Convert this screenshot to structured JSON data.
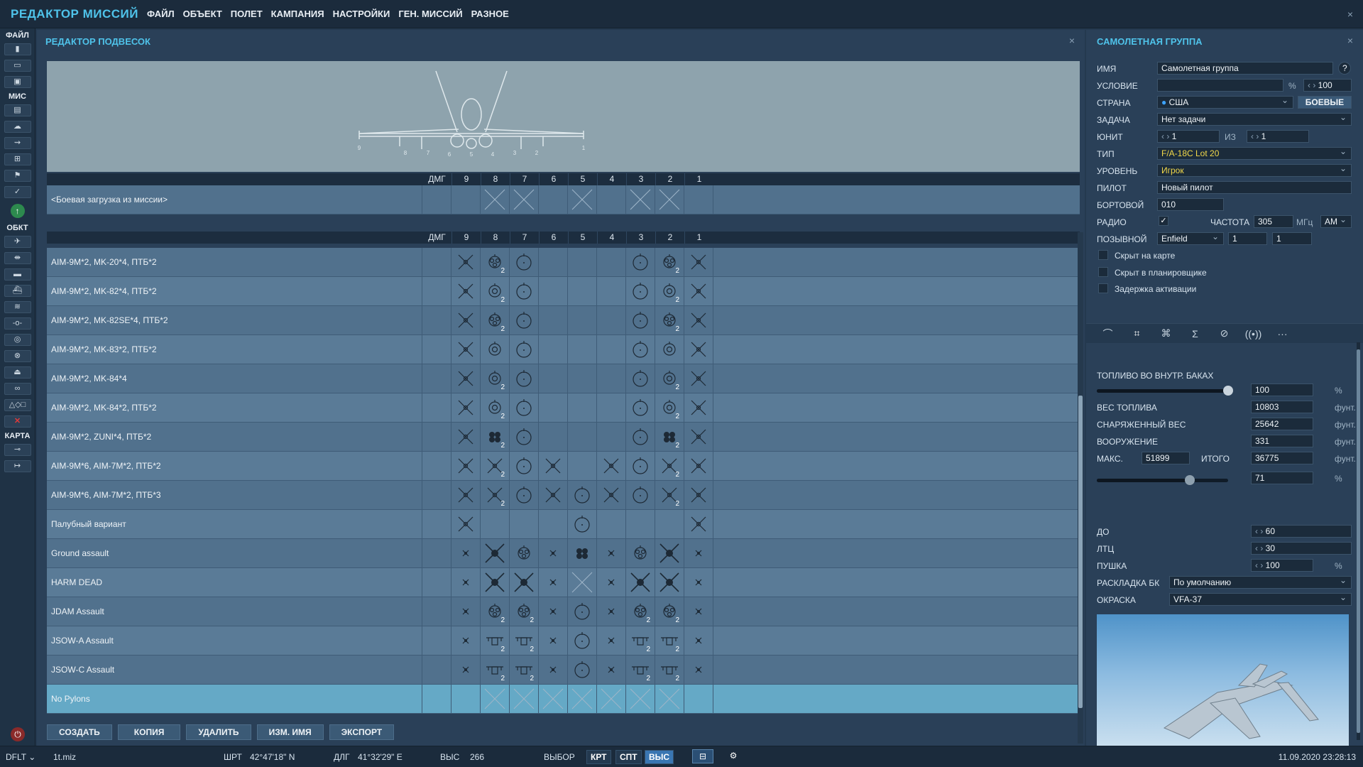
{
  "app": {
    "title": "РЕДАКТОР МИССИЙ",
    "menu": [
      "ФАЙЛ",
      "ОБЪЕКТ",
      "ПОЛЕТ",
      "КАМПАНИЯ",
      "НАСТРОЙКИ",
      "ГЕН. МИССИЙ",
      "РАЗНОЕ"
    ],
    "close": "×"
  },
  "toolbar": {
    "file_label": "ФАЙЛ",
    "mis_label": "МИС",
    "obj_label": "ОБКТ",
    "map_label": "КАРТА"
  },
  "editor": {
    "title": "РЕДАКТОР ПОДВЕСОК",
    "close": "×",
    "dmg_header": "ДМГ",
    "stations": [
      "9",
      "8",
      "7",
      "6",
      "5",
      "4",
      "3",
      "2",
      "1"
    ],
    "mission_loadout": {
      "name": "<Боевая загрузка из миссии>",
      "cells": [
        "",
        "x",
        "x",
        "",
        "x",
        "",
        "x",
        "x",
        ""
      ]
    },
    "rows": [
      {
        "name": "AIM-9M*2, MK-20*4, ПТБ*2",
        "cells": [
          "aim",
          "rack|2",
          "tank",
          "",
          "",
          "",
          "tank",
          "rack|2",
          "aim"
        ]
      },
      {
        "name": "AIM-9M*2, MK-82*4, ПТБ*2",
        "cells": [
          "aim",
          "bomb|2",
          "tank",
          "",
          "",
          "",
          "tank",
          "bomb|2",
          "aim"
        ]
      },
      {
        "name": "AIM-9M*2, MK-82SE*4, ПТБ*2",
        "cells": [
          "aim",
          "rack|2",
          "tank",
          "",
          "",
          "",
          "tank",
          "rack|2",
          "aim"
        ]
      },
      {
        "name": "AIM-9M*2, MK-83*2, ПТБ*2",
        "cells": [
          "aim",
          "bomb",
          "tank",
          "",
          "",
          "",
          "tank",
          "bomb",
          "aim"
        ]
      },
      {
        "name": "AIM-9M*2, MK-84*4",
        "cells": [
          "aim",
          "bomb|2",
          "tank",
          "",
          "",
          "",
          "tank",
          "bomb|2",
          "aim"
        ]
      },
      {
        "name": "AIM-9M*2, MK-84*2, ПТБ*2",
        "cells": [
          "aim",
          "bomb|2",
          "tank",
          "",
          "",
          "",
          "tank",
          "bomb|2",
          "aim"
        ]
      },
      {
        "name": "AIM-9M*2, ZUNI*4, ПТБ*2",
        "cells": [
          "aim",
          "pod|2",
          "tank",
          "",
          "",
          "",
          "tank",
          "pod|2",
          "aim"
        ]
      },
      {
        "name": "AIM-9M*6, AIM-7M*2, ПТБ*2",
        "cells": [
          "aim",
          "aim|2",
          "tank",
          "aim",
          "",
          "aim",
          "tank",
          "aim|2",
          "aim"
        ]
      },
      {
        "name": "AIM-9M*6, AIM-7M*2, ПТБ*3",
        "cells": [
          "aim",
          "aim|2",
          "tank",
          "aim",
          "tank",
          "aim",
          "tank",
          "aim|2",
          "aim"
        ]
      },
      {
        "name": "Палубный вариант",
        "cells": [
          "aim",
          "",
          "",
          "",
          "tank",
          "",
          "",
          "",
          "aim"
        ]
      },
      {
        "name": "Ground assault",
        "cells": [
          "small",
          "big",
          "rack",
          "small",
          "pod",
          "small",
          "rack",
          "big",
          "small"
        ]
      },
      {
        "name": "HARM DEAD",
        "cells": [
          "small",
          "big",
          "big",
          "small",
          "x",
          "small",
          "big",
          "big",
          "small"
        ]
      },
      {
        "name": "JDAM Assault",
        "cells": [
          "small",
          "rack|2",
          "rack|2",
          "small",
          "tank",
          "small",
          "rack|2",
          "rack|2",
          "small"
        ]
      },
      {
        "name": "JSOW-A Assault",
        "cells": [
          "small",
          "wing|2",
          "wing|2",
          "small",
          "tank",
          "small",
          "wing|2",
          "wing|2",
          "small"
        ]
      },
      {
        "name": "JSOW-C Assault",
        "cells": [
          "small",
          "wing|2",
          "wing|2",
          "small",
          "tank",
          "small",
          "wing|2",
          "wing|2",
          "small"
        ]
      },
      {
        "name": "No Pylons",
        "cells": [
          "",
          "x",
          "x",
          "x",
          "x",
          "x",
          "x",
          "x",
          ""
        ]
      }
    ],
    "buttons": [
      "СОЗДАТЬ",
      "КОПИЯ",
      "УДАЛИТЬ",
      "ИЗМ. ИМЯ",
      "ЭКСПОРТ"
    ]
  },
  "group": {
    "title": "САМОЛЕТНАЯ ГРУППА",
    "close": "×",
    "name_label": "ИМЯ",
    "name_value": "Самолетная группа",
    "help": "?",
    "condition_label": "УСЛОВИЕ",
    "condition_value": "",
    "percent": "%",
    "probability": "100",
    "country_label": "СТРАНА",
    "country_value": "США",
    "combat_button": "БОЕВЫЕ",
    "task_label": "ЗАДАЧА",
    "task_value": "Нет задачи",
    "unit_label": "ЮНИТ",
    "unit_value": "1",
    "of_label": "ИЗ",
    "unit_total": "1",
    "type_label": "ТИП",
    "type_value": "F/A-18C Lot 20",
    "skill_label": "УРОВЕНЬ",
    "skill_value": "Игрок",
    "pilot_label": "ПИЛОТ",
    "pilot_value": "Новый пилот",
    "tail_label": "БОРТОВОЙ",
    "tail_value": "010",
    "radio_label": "РАДИО",
    "radio_check": "✓",
    "freq_label": "ЧАСТОТА",
    "freq_value": "305",
    "freq_unit": "МГц",
    "modulation": "AM",
    "callsign_label": "ПОЗЫВНОЙ",
    "callsign_value": "Enfield",
    "callsign_n1": "1",
    "callsign_n2": "1",
    "hidden_map": "Скрыт на карте",
    "hidden_planner": "Скрыт в планировщике",
    "late_activation": "Задержка активации",
    "tabs": [
      "route-icon",
      "payload-icon",
      "waypoints-icon",
      "summary-icon",
      "failures-icon",
      "radio-icon",
      "more-icon"
    ],
    "fuel_label": "ТОПЛИВО ВО ВНУТР. БАКАХ",
    "fuel_pct": "100",
    "fuel_fraction": 1.0,
    "pct_unit": "%",
    "fuel_weight_label": "ВЕС ТОПЛИВА",
    "fuel_weight": "10803",
    "empty_weight_label": "СНАРЯЖЕННЫЙ ВЕС",
    "empty_weight": "25642",
    "weapons_label": "ВООРУЖЕНИЕ",
    "weapons_weight": "331",
    "max_label": "МАКС.",
    "max_value": "51899",
    "total_label": "ИТОГО",
    "total_value": "36775",
    "weight_unit": "фунт.",
    "weight_pct": "71",
    "weight_fraction": 0.71,
    "chaff_label": "ДО",
    "chaff_value": "60",
    "flare_label": "ЛТЦ",
    "flare_value": "30",
    "gun_label": "ПУШКА",
    "gun_value": "100",
    "ammo_label": "РАСКЛАДКА БК",
    "ammo_value": "По умолчанию",
    "livery_label": "ОКРАСКА",
    "livery_value": "VFA-37"
  },
  "status": {
    "layer": "DFLT",
    "file": "1t.miz",
    "lat_label": "ШРТ",
    "lat": "42°47'18\" N",
    "lon_label": "ДЛГ",
    "lon": "41°32'29\" E",
    "alt_label": "ВЫС",
    "alt": "266",
    "select_label": "ВЫБОР",
    "modes": [
      "КРТ",
      "СПТ",
      "ВЫС"
    ],
    "datetime": "11.09.2020 23:28:13"
  }
}
